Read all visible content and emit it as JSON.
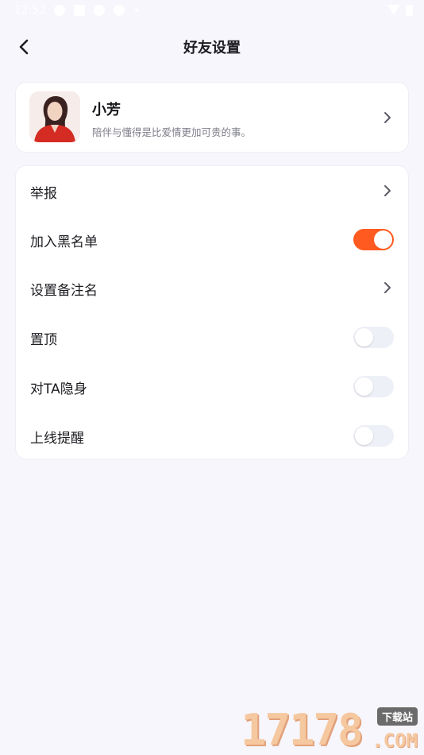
{
  "status_bar": {
    "time": "12:52",
    "icons": [
      "settings-icon",
      "square-icon",
      "settings-icon",
      "settings-icon",
      "dot-icon",
      "wifi-icon",
      "battery-icon"
    ]
  },
  "header": {
    "back_icon": "back-arrow-icon",
    "title": "好友设置"
  },
  "profile": {
    "name": "小芳",
    "bio": "陪伴与懂得是比爱情更加可贵的事。",
    "avatar_icon": "avatar-photo"
  },
  "settings": {
    "items": [
      {
        "label": "举报",
        "control": "chevron"
      },
      {
        "label": "加入黑名单",
        "control": "toggle",
        "on": true
      },
      {
        "label": "设置备注名",
        "control": "chevron"
      },
      {
        "label": "置顶",
        "control": "toggle",
        "on": false
      },
      {
        "label": "对TA隐身",
        "control": "toggle",
        "on": false
      },
      {
        "label": "上线提醒",
        "control": "toggle",
        "on": false
      }
    ]
  },
  "colors": {
    "accent": "#ff5a1f",
    "background": "#f6f6fc",
    "card": "#ffffff",
    "toggle_off": "#eef0f7"
  },
  "watermark": {
    "number": "17178",
    "tag": "下载站",
    "suffix": ".COM"
  }
}
